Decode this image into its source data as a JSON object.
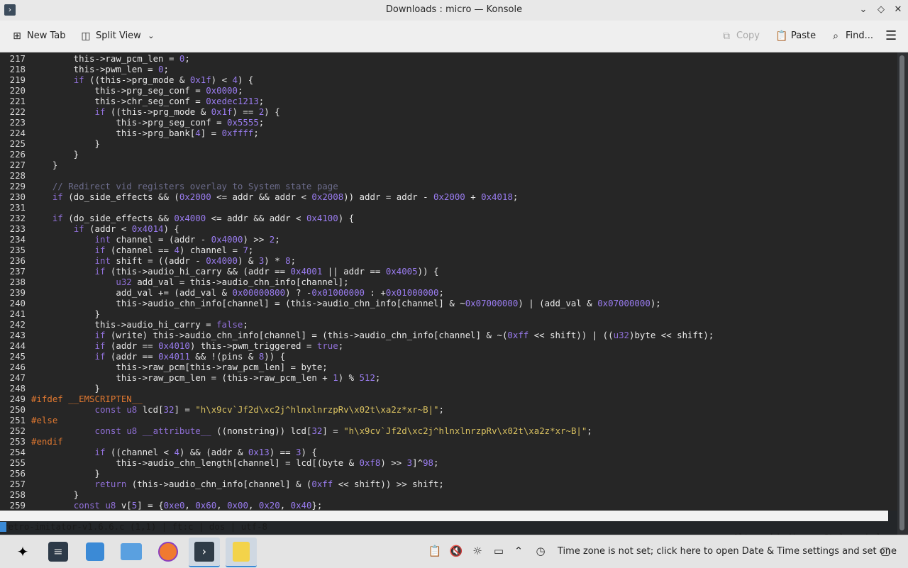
{
  "window": {
    "title": "Downloads : micro — Konsole"
  },
  "toolbar": {
    "new_tab": "New Tab",
    "split_view": "Split View",
    "copy": "Copy",
    "paste": "Paste",
    "find": "Find..."
  },
  "editor": {
    "lines": [
      {
        "n": "217",
        "text": "        this->raw_pcm_len = 0;"
      },
      {
        "n": "218",
        "text": "        this->pwm_len = 0;"
      },
      {
        "n": "219",
        "text": "        if ((this->prg_mode & 0x1f) < 4) {"
      },
      {
        "n": "220",
        "text": "            this->prg_seg_conf = 0x0000;"
      },
      {
        "n": "221",
        "text": "            this->chr_seg_conf = 0xedec1213;"
      },
      {
        "n": "222",
        "text": "            if ((this->prg_mode & 0x1f) == 2) {"
      },
      {
        "n": "223",
        "text": "                this->prg_seg_conf = 0x5555;"
      },
      {
        "n": "224",
        "text": "                this->prg_bank[4] = 0xffff;"
      },
      {
        "n": "225",
        "text": "            }"
      },
      {
        "n": "226",
        "text": "        }"
      },
      {
        "n": "227",
        "text": "    }"
      },
      {
        "n": "228",
        "text": ""
      },
      {
        "n": "229",
        "text": "    // Redirect vid registers overlay to System state page"
      },
      {
        "n": "230",
        "text": "    if (do_side_effects && (0x2000 <= addr && addr < 0x2008)) addr = addr - 0x2000 + 0x4018;"
      },
      {
        "n": "231",
        "text": ""
      },
      {
        "n": "232",
        "text": "    if (do_side_effects && 0x4000 <= addr && addr < 0x4100) {"
      },
      {
        "n": "233",
        "text": "        if (addr < 0x4014) {"
      },
      {
        "n": "234",
        "text": "            int channel = (addr - 0x4000) >> 2;"
      },
      {
        "n": "235",
        "text": "            if (channel == 4) channel = 7;"
      },
      {
        "n": "236",
        "text": "            int shift = ((addr - 0x4000) & 3) * 8;"
      },
      {
        "n": "237",
        "text": "            if (this->audio_hi_carry && (addr == 0x4001 || addr == 0x4005)) {"
      },
      {
        "n": "238",
        "text": "                u32 add_val = this->audio_chn_info[channel];"
      },
      {
        "n": "239",
        "text": "                add_val += (add_val & 0x00000800) ? -0x01000000 : +0x01000000;"
      },
      {
        "n": "240",
        "text": "                this->audio_chn_info[channel] = (this->audio_chn_info[channel] & ~0x07000000) | (add_val & 0x07000000);"
      },
      {
        "n": "241",
        "text": "            }"
      },
      {
        "n": "242",
        "text": "            this->audio_hi_carry = false;"
      },
      {
        "n": "243",
        "text": "            if (write) this->audio_chn_info[channel] = (this->audio_chn_info[channel] & ~(0xff << shift)) | ((u32)byte << shift);"
      },
      {
        "n": "244",
        "text": "            if (addr == 0x4010) this->pwm_triggered = true;"
      },
      {
        "n": "245",
        "text": "            if (addr == 0x4011 && !(pins & 8)) {"
      },
      {
        "n": "246",
        "text": "                this->raw_pcm[this->raw_pcm_len] = byte;"
      },
      {
        "n": "247",
        "text": "                this->raw_pcm_len = (this->raw_pcm_len + 1) % 512;"
      },
      {
        "n": "248",
        "text": "            }"
      },
      {
        "n": "249",
        "text": "#ifdef __EMSCRIPTEN__"
      },
      {
        "n": "250",
        "text": "            const u8 lcd[32] = \"h\\x9cv`Jf2d\\xc2j^hlnxlnrzpRv\\x02t\\xa2z*xr~B|\";"
      },
      {
        "n": "251",
        "text": "#else"
      },
      {
        "n": "252",
        "text": "            const u8 __attribute__ ((nonstring)) lcd[32] = \"h\\x9cv`Jf2d\\xc2j^hlnxlnrzpRv\\x02t\\xa2z*xr~B|\";"
      },
      {
        "n": "253",
        "text": "#endif"
      },
      {
        "n": "254",
        "text": "            if ((channel < 4) && (addr & 0x13) == 3) {"
      },
      {
        "n": "255",
        "text": "                this->audio_chn_length[channel] = lcd[(byte & 0xf8) >> 3]^98;"
      },
      {
        "n": "256",
        "text": "            }"
      },
      {
        "n": "257",
        "text": "            return (this->audio_chn_info[channel] & (0xff << shift)) >> shift;"
      },
      {
        "n": "258",
        "text": "        }"
      },
      {
        "n": "259",
        "text": "        const u8 v[5] = {0xe0, 0x60, 0x00, 0x20, 0x40};"
      }
    ]
  },
  "statusline": {
    "left": "retro-imitator-v1.6.6.c (1,1) | ft:c | dos | utf-8",
    "right": "Alt-g: bindings, Ctrl-g: help"
  },
  "taskbar": {
    "tray_text": "Time zone is not set; click here to open Date & Time settings and set one"
  },
  "colors": {
    "background": "#262626",
    "keyword": "#8f6fd6",
    "number": "#9a7cf0",
    "string": "#d8c060",
    "preprocessor": "#e07830",
    "comment": "#6c6c8c",
    "operator": "#9a5050"
  }
}
